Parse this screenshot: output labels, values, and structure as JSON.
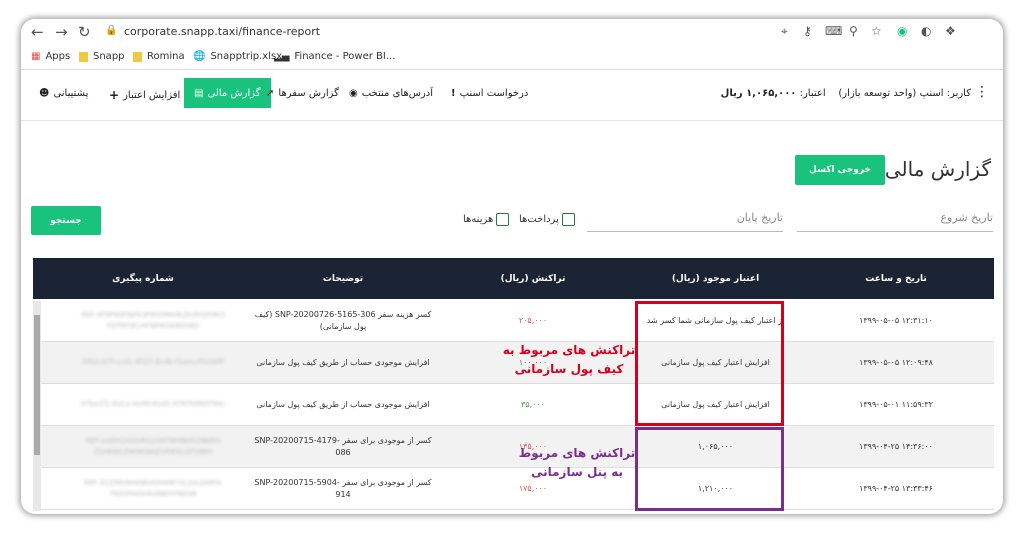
{
  "browser": {
    "url": "corporate.snapp.taxi/finance-report",
    "bookmarks": [
      "Apps",
      "Snapp",
      "Romina",
      "Snapptrip.xlsx",
      "Finance - Power BI..."
    ]
  },
  "header": {
    "menu": {
      "support": "پشتیبانی",
      "add_credit": "افزایش اعتبار",
      "finance_report": "گزارش مالی",
      "trip_report": "گزارش سفرها",
      "selected_addresses": "آدرس‌های منتخب",
      "request_snapp": "درخواست اسنپ"
    },
    "user_label": "کاربر:",
    "user_name": "اسنپ (واحد توسعه بازار)",
    "credit_label": "اعتبار:",
    "credit_value": "۱,۰۶۵,۰۰۰ ریال"
  },
  "page": {
    "title": "گزارش مالی",
    "export_button": "خروجی اکسل",
    "search_button": "جستجو",
    "start_date_placeholder": "تاریخ شروع",
    "end_date_placeholder": "تاریخ پایان",
    "filter_payments": "پرداخت‌ها",
    "filter_costs": "هزینه‌ها"
  },
  "table": {
    "headers": {
      "datetime": "تاریخ و ساعت",
      "balance": "اعتبار موجود (ریال)",
      "amount": "تراکنش (ریال)",
      "description": "توضیحات",
      "tracking": "شماره پیگیری"
    },
    "rows": [
      {
        "datetime": "۱۳۹۹-۰۵-۰۵ ۱۲:۳۱:۱۰",
        "balance": "از اعتبار کیف پول سازمانی شما کسر شد",
        "amount": "۲۰۵,۰۰۰",
        "amount_color": "red",
        "description": "کسر هزینه سفر SNP-20200726-5165-306 (کیف پول سازمانی)",
        "tracking": "REF-0F8FK9F8JFA3F8SDMA9LDURIQ59K3 FDTRF9I1HFNPIKSK8D08D"
      },
      {
        "datetime": "۱۳۹۹-۰۵-۰۵ ۱۲:۰۹:۴۸",
        "balance": "افزایش اعتبار کیف پول سازمانی",
        "amount": "۱۰۰,۰۰۰",
        "amount_color": "green",
        "description": "افزایش موجودی حساب از طریق کیف پول سازمانی",
        "tracking": "0f02c07f-ccd1-4f1f7-8c4b-f2aeccf0209ff"
      },
      {
        "datetime": "۱۳۹۹-۰۵-۰۱ ۱۱:۵۹:۳۲",
        "balance": "افزایش اعتبار کیف پول سازمانی",
        "amount": "۳۵,۰۰۰",
        "amount_color": "green",
        "description": "افزایش موجودی حساب از طریق کیف پول سازمانی",
        "tracking": "97be1f1-8a1a-4e48-81d2-4767b68d79ec"
      },
      {
        "datetime": "۱۳۹۹-۰۴-۲۵ ۱۴:۳۶:۰۰",
        "balance": "۱,۰۶۵,۰۰۰",
        "amount": "۱۴۵,۰۰۰",
        "amount_color": "red",
        "description": "کسر از موجودی برای سفر SNP-20200715-4179-086",
        "tracking": "REF-A4DH2AOGRILVVKTMHBHGZ8KRG ZSH6WLDW8KWAEVRNVLGFS9BH"
      },
      {
        "datetime": "۱۳۹۹-۰۴-۲۵ ۱۳:۳۳:۴۶",
        "balance": "۱,۲۱۰,۰۰۰",
        "amount": "۱۷۵,۰۰۰",
        "amount_color": "red",
        "description": "کسر از موجودی برای سفر SNP-20200715-5904-914",
        "tracking": "REF-D1ZMH9HK8E4SH44F7Q.JULZARFA TKD2FAOX4UINEHYNDS6"
      }
    ]
  },
  "annotations": {
    "wallet_note_line1": "تراکنش های مربوط به",
    "wallet_note_line2": "کیف پول سازمانی",
    "panel_note_line1": "تراکنش های مربوط",
    "panel_note_line2": "به پنل سازمانی",
    "wallet_color": "#d6001c",
    "panel_color": "#7b2d8e"
  },
  "colors": {
    "accent": "#19c37d",
    "table_header": "#1b2434"
  }
}
